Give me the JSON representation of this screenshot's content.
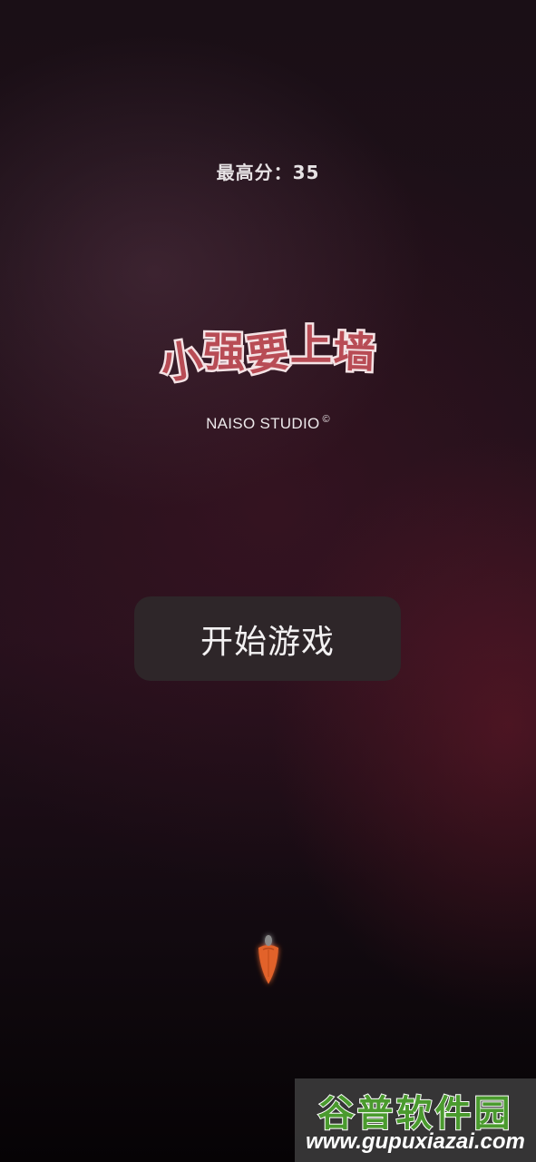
{
  "game": {
    "high_score_label": "最高分：",
    "high_score_value": "35",
    "title_chars": [
      "小",
      "强",
      "要",
      "上",
      "墙"
    ],
    "studio": "NAISO STUDIO",
    "studio_mark": "©",
    "start_button": "开始游戏"
  },
  "watermark": {
    "title": "谷普软件园",
    "url": "www.gupuxiazai.com"
  },
  "colors": {
    "logo_fill": "#b84c55",
    "logo_outline": "#f4e3e5",
    "button_bg": "#2e2629",
    "player": "#e2622a"
  },
  "icons": {
    "player": "carrot-icon"
  }
}
